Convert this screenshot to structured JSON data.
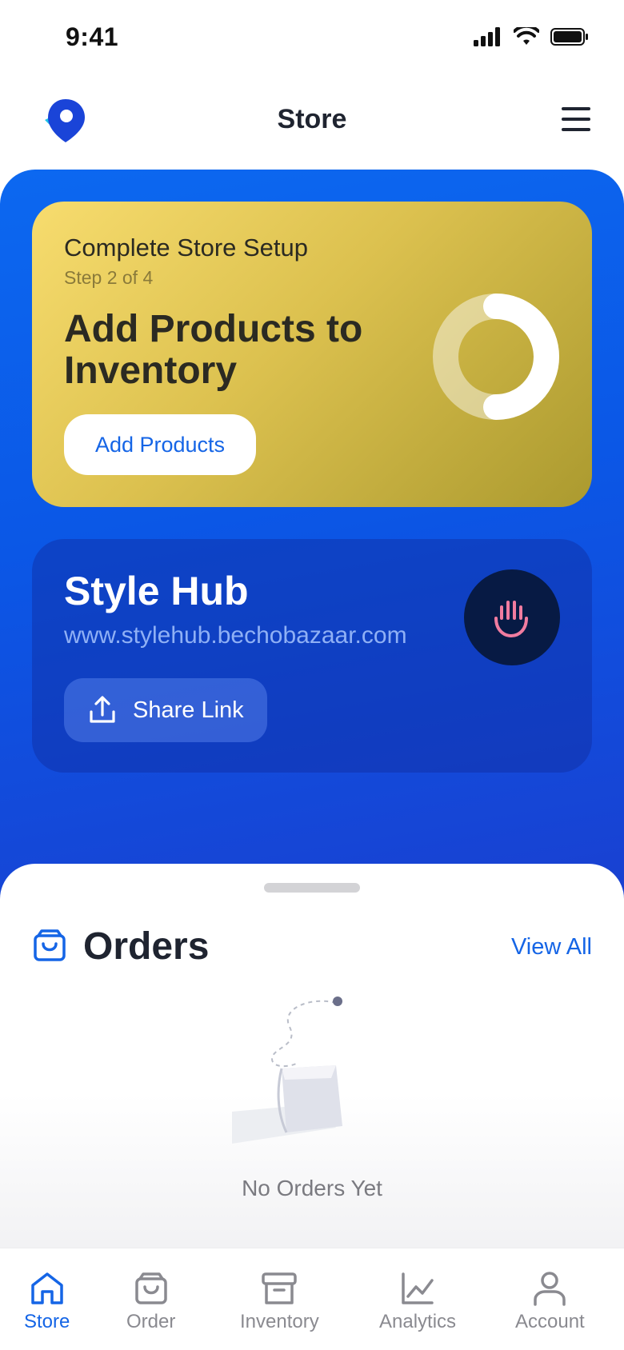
{
  "status_bar": {
    "time": "9:41"
  },
  "header": {
    "title": "Store",
    "logo_icon": "location-pin-logo",
    "menu_icon": "hamburger-menu-icon"
  },
  "setup_card": {
    "kicker": "Complete Store Setup",
    "step": "Step 2 of 4",
    "title": "Add Products to Inventory",
    "button_label": "Add Products",
    "progress_fraction": 0.5
  },
  "store_card": {
    "name": "Style Hub",
    "url": "www.stylehub.bechobazaar.com",
    "share_label": "Share Link",
    "badge_icon": "hand-icon"
  },
  "orders": {
    "title": "Orders",
    "view_all": "View All",
    "empty_text": "No Orders Yet"
  },
  "tabs": [
    {
      "label": "Store",
      "icon": "home-icon",
      "active": true
    },
    {
      "label": "Order",
      "icon": "shopping-bag-icon",
      "active": false
    },
    {
      "label": "Inventory",
      "icon": "archive-box-icon",
      "active": false
    },
    {
      "label": "Analytics",
      "icon": "chart-line-icon",
      "active": false
    },
    {
      "label": "Account",
      "icon": "user-icon",
      "active": false
    }
  ],
  "colors": {
    "primary_blue": "#1565e6",
    "gold_start": "#f7dc6e",
    "gold_end": "#ab9a2f",
    "dark_navy": "#071a44"
  }
}
